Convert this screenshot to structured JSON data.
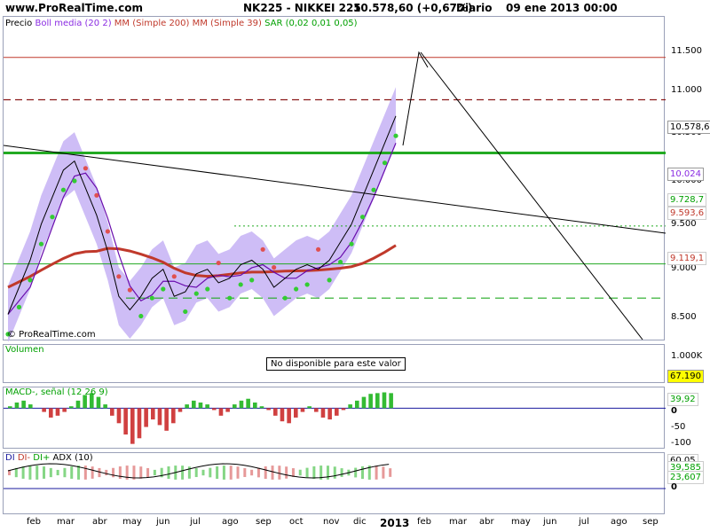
{
  "header": {
    "site": "www.ProRealTime.com",
    "instrument": "NK225 - NIKKEI 225",
    "quote": "10.578,60 (+0,67%)",
    "period": "Diario",
    "datetime": "09 ene 2013 00:00"
  },
  "watermark": "© ProRealTime.com",
  "colors": {
    "price": "#000000",
    "boll": "#8a2be2",
    "mm200": "#c0392b",
    "mm39": "#c0392b",
    "sar": "#00a000",
    "legend_blue": "#1a1a9e",
    "panel_border": "#9aa0b8"
  },
  "legends": {
    "price": [
      "Precio",
      "Boll media (20 2)",
      "MM (Simple 200)",
      "MM (Simple 39)",
      "SAR (0,02 0,01 0,05)"
    ],
    "volume": "Volumen",
    "macd": "MACD-, señal (12 26 9)",
    "dmi": [
      "DI",
      "DI-",
      "DI+",
      "ADX (10)"
    ]
  },
  "volume_message": "No disponible para este valor",
  "chart_data": [
    {
      "type": "line",
      "name": "price",
      "x_labels": [
        "feb",
        "mar",
        "abr",
        "may",
        "jun",
        "jul",
        "ago",
        "sep",
        "oct",
        "nov",
        "dic",
        "2013",
        "feb",
        "mar",
        "abr",
        "may",
        "jun",
        "jul",
        "ago",
        "sep"
      ],
      "y_ticks": [
        "11.500",
        "11.000",
        "10.500",
        "10.000",
        "9.500",
        "9.000",
        "8.500"
      ],
      "ylim": [
        8200,
        11800
      ],
      "last_price": 10578.6,
      "series": [
        {
          "values": [
            8500,
            8800,
            9100,
            9500,
            9800,
            10100,
            10200,
            9900,
            9600,
            9200,
            8700,
            8550,
            8700,
            8900,
            9000,
            8700,
            8750,
            8950,
            9000,
            8850,
            8900,
            9050,
            9100,
            9000,
            8800,
            8900,
            9000,
            9050,
            9000,
            9100,
            9300,
            9500,
            9800,
            10100,
            10400,
            10700
          ]
        }
      ],
      "horizontal_levels": [
        11350,
        10880,
        10290,
        9480,
        9060,
        8680
      ],
      "value_badges": [
        "10.578,6",
        "10.024",
        "9.728,7",
        "9.593,6",
        "9.119,1"
      ]
    },
    {
      "type": "line",
      "name": "volume",
      "y_ticks": [
        "1.000K",
        "0"
      ],
      "last_value": "67.190"
    },
    {
      "type": "bar",
      "name": "macd",
      "y_ticks": [
        "0",
        "-50",
        "-100"
      ],
      "ylim": [
        -110,
        55
      ],
      "last_value": "39,92",
      "values": [
        5,
        15,
        20,
        10,
        0,
        -10,
        -25,
        -20,
        -10,
        5,
        20,
        35,
        40,
        30,
        10,
        -20,
        -40,
        -70,
        -95,
        -80,
        -50,
        -30,
        -45,
        -60,
        -40,
        -10,
        10,
        20,
        15,
        10,
        -5,
        -20,
        -10,
        10,
        20,
        25,
        15,
        5,
        -5,
        -20,
        -35,
        -40,
        -25,
        -10,
        5,
        -10,
        -25,
        -30,
        -20,
        -5,
        10,
        20,
        30,
        38,
        40,
        42,
        40
      ]
    },
    {
      "type": "line",
      "name": "dmi",
      "y_ticks": [
        "0"
      ],
      "last_values": [
        "60,05",
        "39,585",
        "23,607"
      ]
    }
  ]
}
